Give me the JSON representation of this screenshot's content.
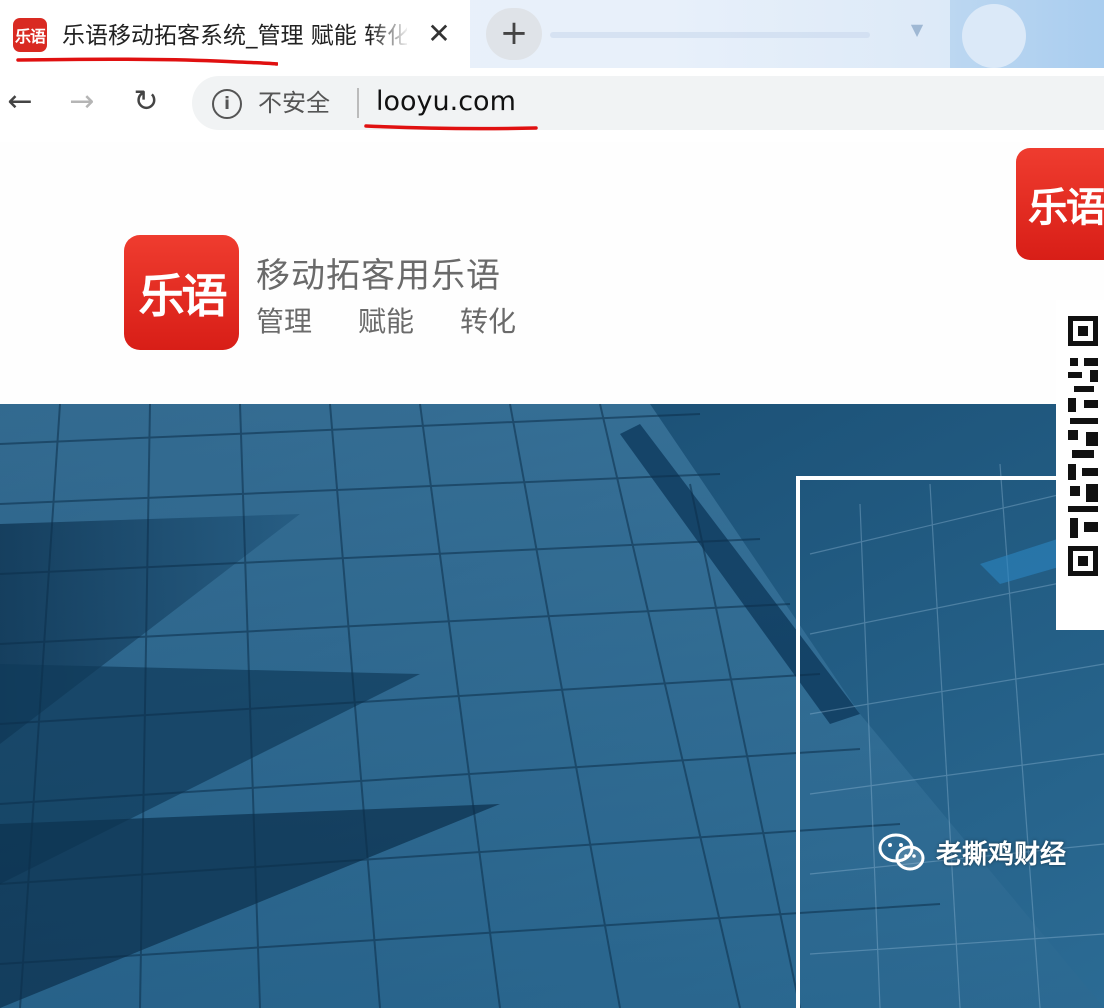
{
  "browser": {
    "tab": {
      "favicon_text": "乐语",
      "title": "乐语移动拓客系统_管理 赋能 转化",
      "close_glyph": "✕"
    },
    "new_tab_glyph": "+",
    "toolbar": {
      "back_glyph": "←",
      "forward_glyph": "→",
      "reload_glyph": "↻"
    },
    "omnibox": {
      "info_glyph": "i",
      "security_label": "不安全",
      "url": "looyu.com"
    }
  },
  "page": {
    "header": {
      "logo_text": "乐语",
      "slogan": "移动拓客用乐语",
      "tags": [
        "管理",
        "赋能",
        "转化"
      ]
    },
    "hero": {
      "card_logo_text": "乐语"
    },
    "watermark": {
      "text": "老撕鸡财经"
    }
  },
  "colors": {
    "brand_red": "#d92a22",
    "annotation_red": "#e01010",
    "hero_blue": "#2a6d96"
  },
  "icons": [
    "info-icon",
    "back-arrow-icon",
    "forward-arrow-icon",
    "reload-icon",
    "close-icon",
    "plus-icon",
    "wechat-icon",
    "qr-code-icon"
  ]
}
